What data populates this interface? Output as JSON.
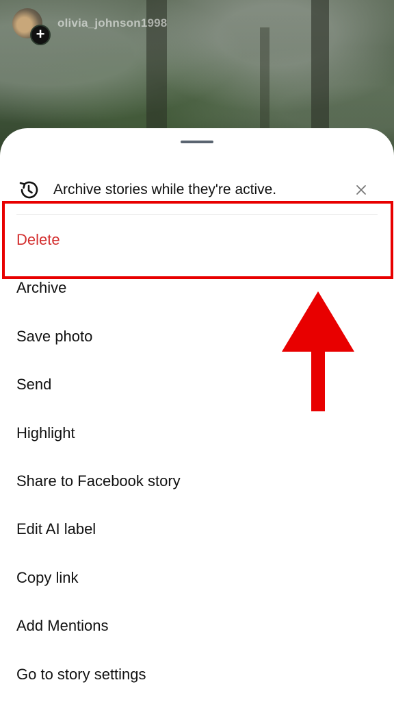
{
  "story": {
    "username": "olivia_johnson1998"
  },
  "sheet": {
    "banner": {
      "text": "Archive stories while they're active.",
      "icon": "history-icon",
      "close_icon": "close-icon"
    },
    "menu_items": [
      {
        "label": "Delete",
        "color": "#d32f2f"
      },
      {
        "label": "Archive"
      },
      {
        "label": "Save photo"
      },
      {
        "label": "Send"
      },
      {
        "label": "Highlight"
      },
      {
        "label": "Share to Facebook story"
      },
      {
        "label": "Edit AI label"
      },
      {
        "label": "Copy link"
      },
      {
        "label": "Add Mentions"
      },
      {
        "label": "Go to story settings"
      }
    ]
  },
  "annotation": {
    "highlight_color": "#e80000",
    "highlighted_item": "Delete",
    "arrow_direction": "up"
  }
}
